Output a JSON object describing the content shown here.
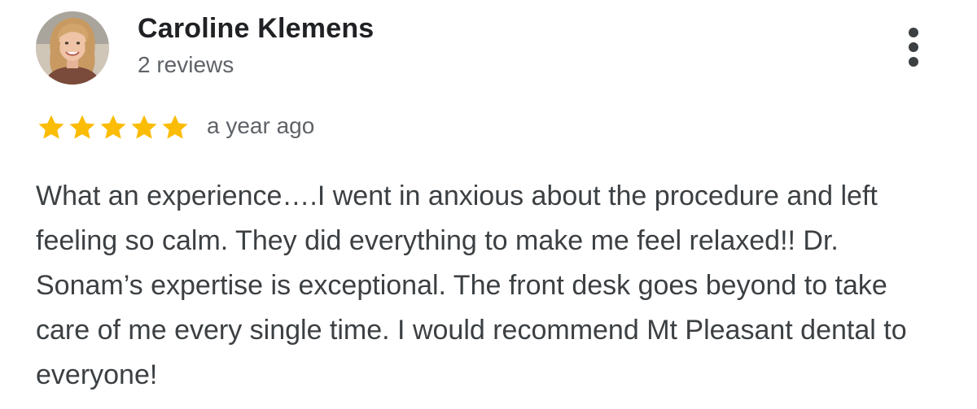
{
  "review": {
    "reviewer_name": "Caroline Klemens",
    "review_count": "2 reviews",
    "rating": 5,
    "rating_max": 5,
    "date": "a year ago",
    "text": "What an experience….I went in anxious about the procedure and left feeling so calm. They did everything to make me feel relaxed!! Dr. Sonam’s expertise is exceptional. The front desk goes beyond to take care of me every single time. I would recommend Mt Pleasant dental to everyone!"
  },
  "icons": {
    "star": "star-icon",
    "more": "more-vert-icon"
  },
  "colors": {
    "star": "#fbbc04",
    "name": "#202124",
    "secondary": "#5f6368",
    "body": "#3c4043"
  }
}
